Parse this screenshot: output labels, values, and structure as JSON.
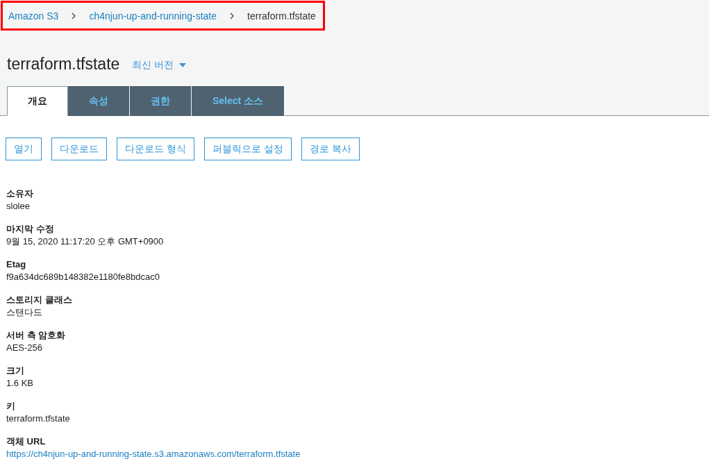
{
  "breadcrumb": [
    {
      "label": "Amazon S3",
      "kind": "link"
    },
    {
      "label": "ch4njun-up-and-running-state",
      "kind": "link"
    },
    {
      "label": "terraform.tfstate",
      "kind": "current"
    }
  ],
  "title": "terraform.tfstate",
  "version_menu": {
    "label": "최신 버전"
  },
  "tabs": [
    {
      "label": "개요",
      "selected": true
    },
    {
      "label": "속성",
      "selected": false
    },
    {
      "label": "권한",
      "selected": false
    },
    {
      "label": "Select 소스",
      "selected": false
    }
  ],
  "actions": [
    "열기",
    "다운로드",
    "다운로드 형식",
    "퍼블릭으로 설정",
    "경로 복사"
  ],
  "properties": [
    {
      "label": "소유자",
      "value": "slolee",
      "kind": "text"
    },
    {
      "label": "마지막 수정",
      "value": "9월 15, 2020 11:17:20 오후 GMT+0900",
      "kind": "text"
    },
    {
      "label": "Etag",
      "value": "f9a634dc689b148382e1180fe8bdcac0",
      "kind": "text"
    },
    {
      "label": "스토리지 클래스",
      "value": "스탠다드",
      "kind": "text"
    },
    {
      "label": "서버 측 암호화",
      "value": "AES-256",
      "kind": "text"
    },
    {
      "label": "크기",
      "value": "1.6 KB",
      "kind": "text"
    },
    {
      "label": "키",
      "value": "terraform.tfstate",
      "kind": "text"
    },
    {
      "label": "객체 URL",
      "value": "https://ch4njun-up-and-running-state.s3.amazonaws.com/terraform.tfstate",
      "kind": "link"
    }
  ]
}
